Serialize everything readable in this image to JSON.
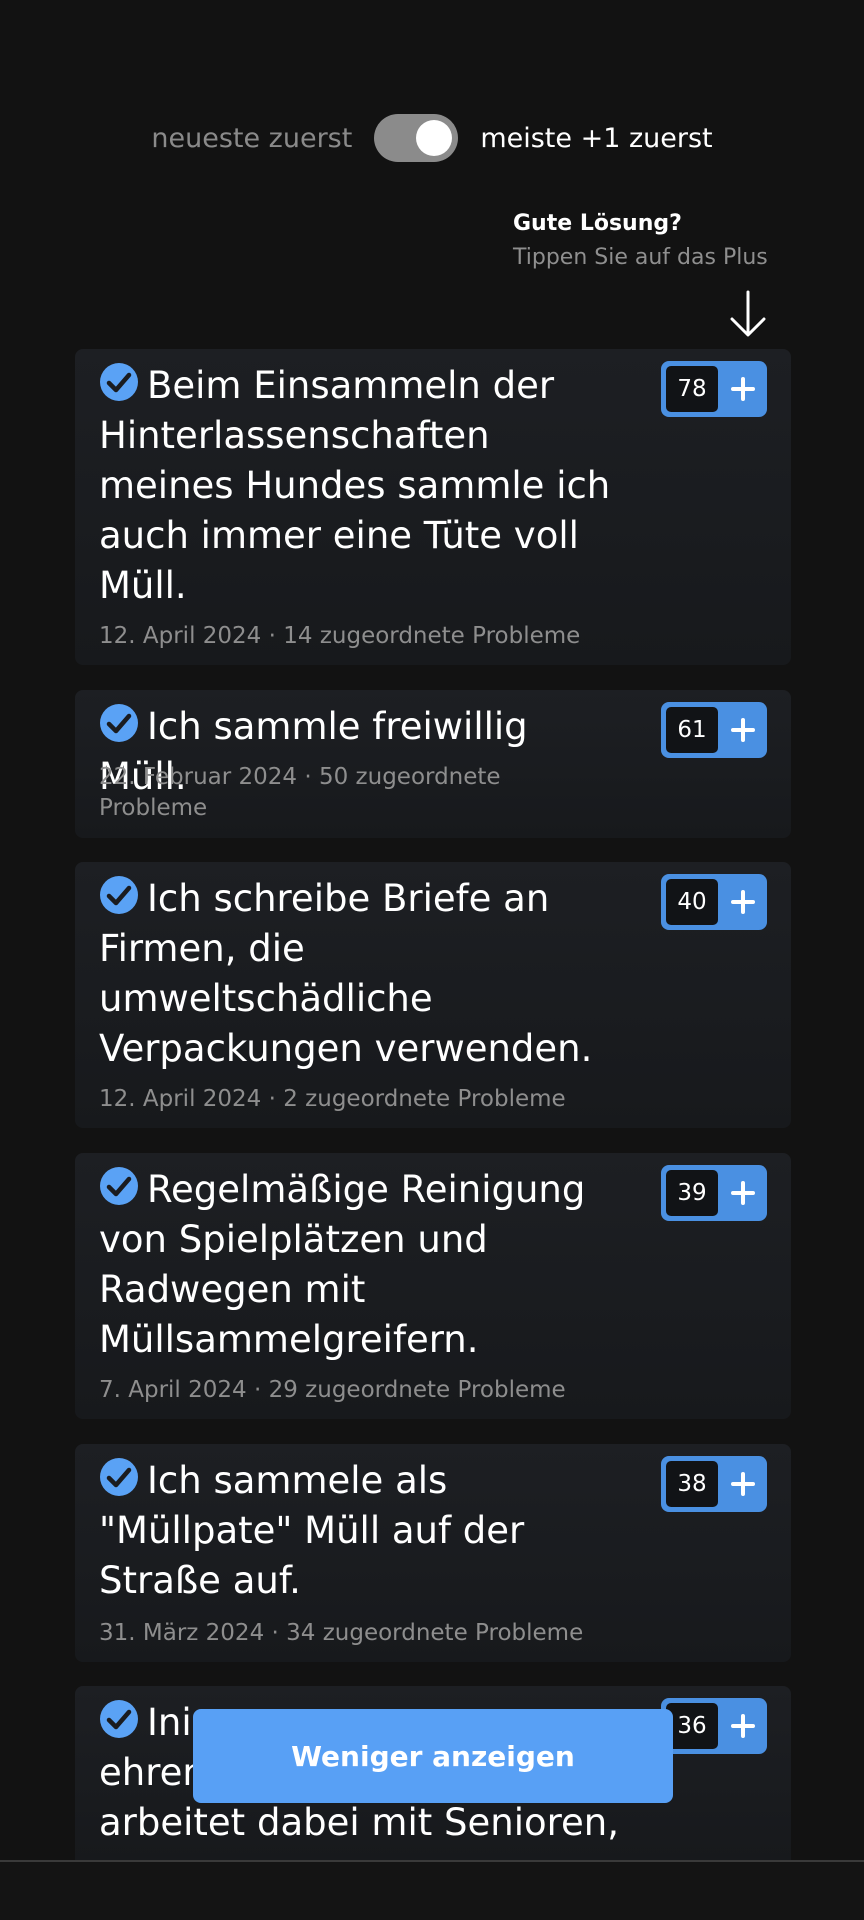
{
  "sort": {
    "left_label": "neueste zuerst",
    "right_label": "meiste +1 zuerst",
    "toggle_state": "right"
  },
  "hint": {
    "title": "Gute Lösung?",
    "subtitle": "Tippen Sie auf das Plus"
  },
  "colors": {
    "background": "#121212",
    "card": "#1b1d21",
    "accent": "#4a90e2",
    "button": "#58a0f5",
    "meta": "#8e8e8e"
  },
  "solutions": [
    {
      "title": "Beim Einsammeln der Hinterlassenschaften meines Hundes sammle ich auch immer eine Tüte voll Müll.",
      "meta": "12. April 2024 · 14 zugeordnete Probleme",
      "votes": "78"
    },
    {
      "title": "Ich sammle freiwillig Müll.",
      "meta": "22. Februar 2024 · 50 zugeordnete Probleme",
      "votes": "61"
    },
    {
      "title": "Ich schreibe Briefe an Firmen, die umweltschädliche Verpackungen verwenden.",
      "meta": "12. April 2024 · 2 zugeordnete Probleme",
      "votes": "40"
    },
    {
      "title": "Regelmäßige Reinigung von Spielplätzen und Radwegen mit Müllsammelgreifern.",
      "meta": "7. April 2024 · 29 zugeordnete Probleme",
      "votes": "39"
    },
    {
      "title": "Ich sammele als \"Müllpate\" Müll auf der Straße auf.",
      "meta": "31. März 2024 · 34 zugeordnete Probleme",
      "votes": "38"
    },
    {
      "title_visible_lines": [
        "Ini",
        "ehren",
        "arbeitet dabei mit Senioren,"
      ],
      "votes": "36"
    }
  ],
  "show_less_label": "Weniger anzeigen"
}
